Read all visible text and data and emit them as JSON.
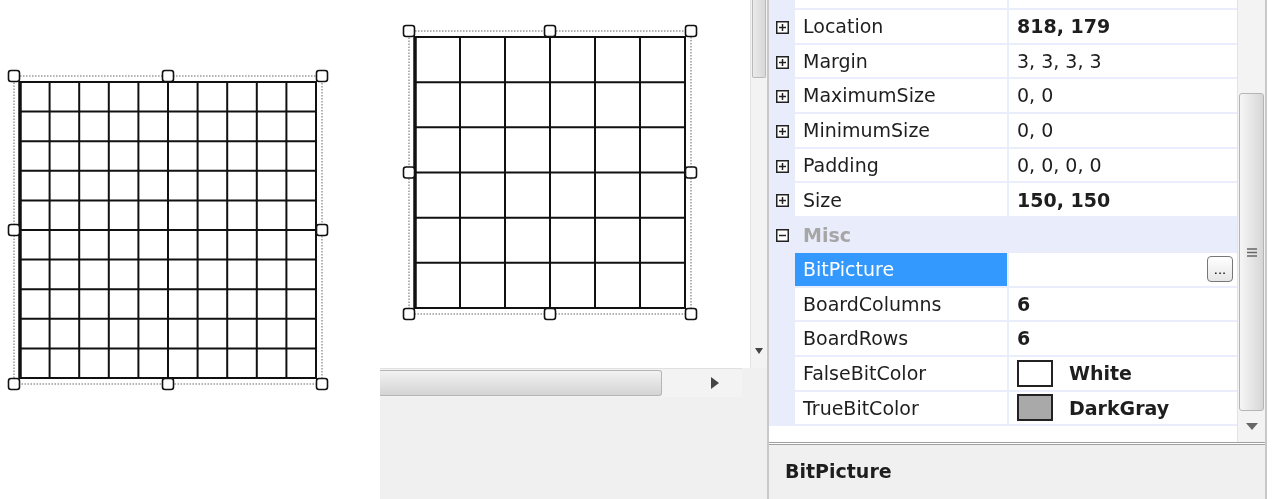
{
  "properties": [
    {
      "kind": "property",
      "name": "Location",
      "value": "818, 179",
      "bold": true,
      "expanded": false,
      "selected": false
    },
    {
      "kind": "property",
      "name": "Margin",
      "value": "3, 3, 3, 3",
      "bold": false,
      "expanded": false,
      "selected": false
    },
    {
      "kind": "property",
      "name": "MaximumSize",
      "value": "0, 0",
      "bold": false,
      "expanded": false,
      "selected": false
    },
    {
      "kind": "property",
      "name": "MinimumSize",
      "value": "0, 0",
      "bold": false,
      "expanded": false,
      "selected": false
    },
    {
      "kind": "property",
      "name": "Padding",
      "value": "0, 0, 0, 0",
      "bold": false,
      "expanded": false,
      "selected": false
    },
    {
      "kind": "property",
      "name": "Size",
      "value": "150, 150",
      "bold": true,
      "expanded": false,
      "selected": false
    },
    {
      "kind": "category",
      "name": "Misc",
      "expanded": true
    },
    {
      "kind": "property",
      "name": "BitPicture",
      "button": "...",
      "selected": true
    },
    {
      "kind": "property",
      "name": "BoardColumns",
      "value": "6",
      "bold": true,
      "selected": false
    },
    {
      "kind": "property",
      "name": "BoardRows",
      "value": "6",
      "bold": true,
      "selected": false
    },
    {
      "kind": "property",
      "name": "FalseBitColor",
      "value": "White",
      "color": "#ffffff",
      "bold": true,
      "selected": false
    },
    {
      "kind": "property",
      "name": "TrueBitColor",
      "value": "DarkGray",
      "color": "#a9a9a9",
      "bold": true,
      "selected": false
    }
  ],
  "description": {
    "title": "BitPicture"
  }
}
